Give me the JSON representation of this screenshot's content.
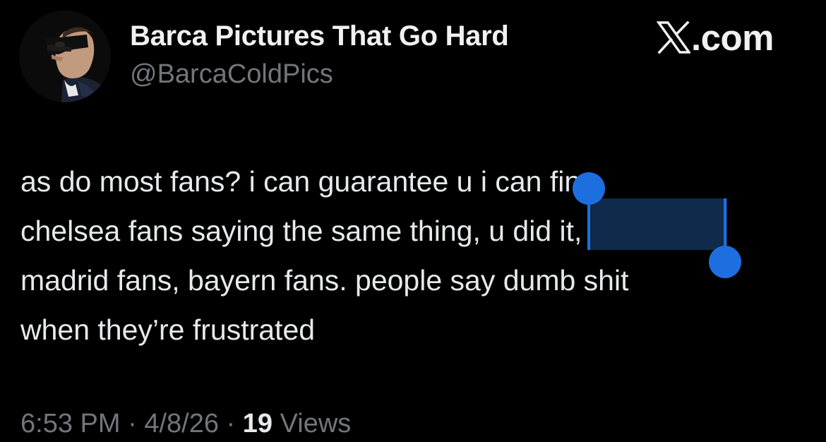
{
  "header": {
    "display_name": "Barca Pictures That Go Hard",
    "handle": "@BarcaColdPics",
    "brand_text": ".com",
    "brand_icon": "x-logo-icon"
  },
  "tweet": {
    "lines": [
      "as do most fans? i can guarantee u i can fine",
      "chelsea fans saying the same thing, u did it,",
      "madrid fans, bayern fans. people say dumb shit",
      "when they’re frustrated"
    ],
    "selected_text": "u did it,"
  },
  "meta": {
    "time": "6:53 PM",
    "separator": " · ",
    "date": "4/8/26",
    "views_count": "19",
    "views_label": "Views"
  },
  "colors": {
    "background": "#000000",
    "text": "#e7e9ea",
    "secondary_text": "#71767b",
    "selection_highlight": "#0f2a4a",
    "selection_handle": "#1d6fe0"
  }
}
